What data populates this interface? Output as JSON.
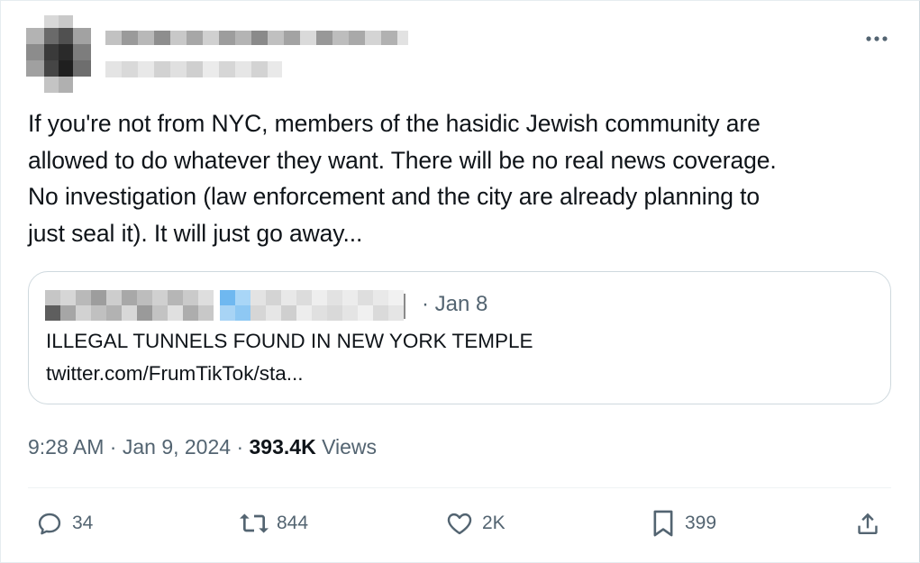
{
  "tweet": {
    "text_lines": [
      "If you're not from NYC, members of the hasidic Jewish community are",
      "allowed to do whatever they want. There will be no real news coverage.",
      "No investigation (law enforcement and the city are already planning to",
      "just seal it). It will just go away..."
    ],
    "more_icon": "more-horizontal-icon"
  },
  "quote": {
    "date": "· Jan 8",
    "text": "ILLEGAL TUNNELS FOUND IN NEW YORK TEMPLE",
    "link": "twitter.com/FrumTikTok/sta..."
  },
  "meta": {
    "time": "9:28 AM",
    "sep1": " · ",
    "date": "Jan 9, 2024",
    "sep2": " · ",
    "views_count": "393.4K",
    "views_label": " Views"
  },
  "actions": {
    "replies": "34",
    "reposts": "844",
    "likes": "2K",
    "bookmarks": "399"
  },
  "colors": {
    "text_primary": "#0f1419",
    "text_secondary": "#536471",
    "border": "#cfd9de"
  }
}
